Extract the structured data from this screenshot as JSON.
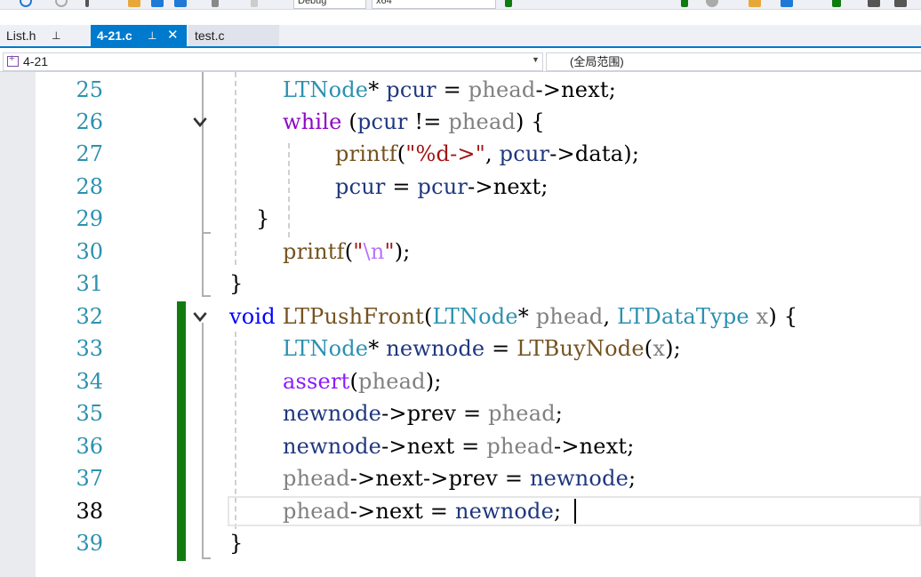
{
  "toolbar": {
    "config_combo": "Debug",
    "platform_combo": "x64"
  },
  "tabs": [
    {
      "label": "List.h",
      "pin": "⎕",
      "active": false
    },
    {
      "label": "4-21.c",
      "pin": "⎕",
      "close": "✕",
      "active": true
    },
    {
      "label": "test.c",
      "active": false
    }
  ],
  "navbar": {
    "project": "4-21",
    "scope": "(全局范围)"
  },
  "editor": {
    "current_line": 38,
    "lines": [
      {
        "num": "25"
      },
      {
        "num": "26"
      },
      {
        "num": "27"
      },
      {
        "num": "28"
      },
      {
        "num": "29"
      },
      {
        "num": "30"
      },
      {
        "num": "31"
      },
      {
        "num": "32"
      },
      {
        "num": "33"
      },
      {
        "num": "34"
      },
      {
        "num": "35"
      },
      {
        "num": "36"
      },
      {
        "num": "37"
      },
      {
        "num": "38"
      },
      {
        "num": "39"
      }
    ],
    "tokens": {
      "l25": [
        "LTNode",
        "* ",
        "pcur",
        " = ",
        "phead",
        "->",
        "next",
        ";"
      ],
      "l26": [
        "while",
        " (",
        "pcur",
        " != ",
        "phead",
        ") {"
      ],
      "l27": [
        "printf",
        "(",
        "\"",
        "%d",
        "->\"",
        ", ",
        "pcur",
        "->",
        "data",
        ");"
      ],
      "l28": [
        "pcur",
        " = ",
        "pcur",
        "->",
        "next",
        ";"
      ],
      "l29": [
        "}"
      ],
      "l30": [
        "printf",
        "(",
        "\"",
        "\\n",
        "\"",
        ");"
      ],
      "l31": [
        "}"
      ],
      "l32": [
        "void",
        " ",
        "LTPushFront",
        "(",
        "LTNode",
        "* ",
        "phead",
        ", ",
        "LTDataType",
        " ",
        "x",
        ") {"
      ],
      "l33": [
        "LTNode",
        "* ",
        "newnode",
        " = ",
        "LTBuyNode",
        "(",
        "x",
        ");"
      ],
      "l34": [
        "assert",
        "(",
        "phead",
        ");"
      ],
      "l35": [
        "newnode",
        "->",
        "prev",
        " = ",
        "phead",
        ";"
      ],
      "l36": [
        "newnode",
        "->",
        "next",
        " = ",
        "phead",
        "->",
        "next",
        ";"
      ],
      "l37": [
        "phead",
        "->",
        "next",
        "->",
        "prev",
        " = ",
        "newnode",
        ";"
      ],
      "l38": [
        "phead",
        "->",
        "next",
        " = ",
        "newnode",
        ";"
      ],
      "l39": [
        "}"
      ]
    }
  },
  "colors": {
    "accent": "#007acc",
    "keyword": "#8f08c4",
    "type": "#2b91af",
    "variable": "#1f377f",
    "parameter": "#808080",
    "function": "#74531f",
    "string": "#a31515",
    "change_bar": "#107c10"
  }
}
